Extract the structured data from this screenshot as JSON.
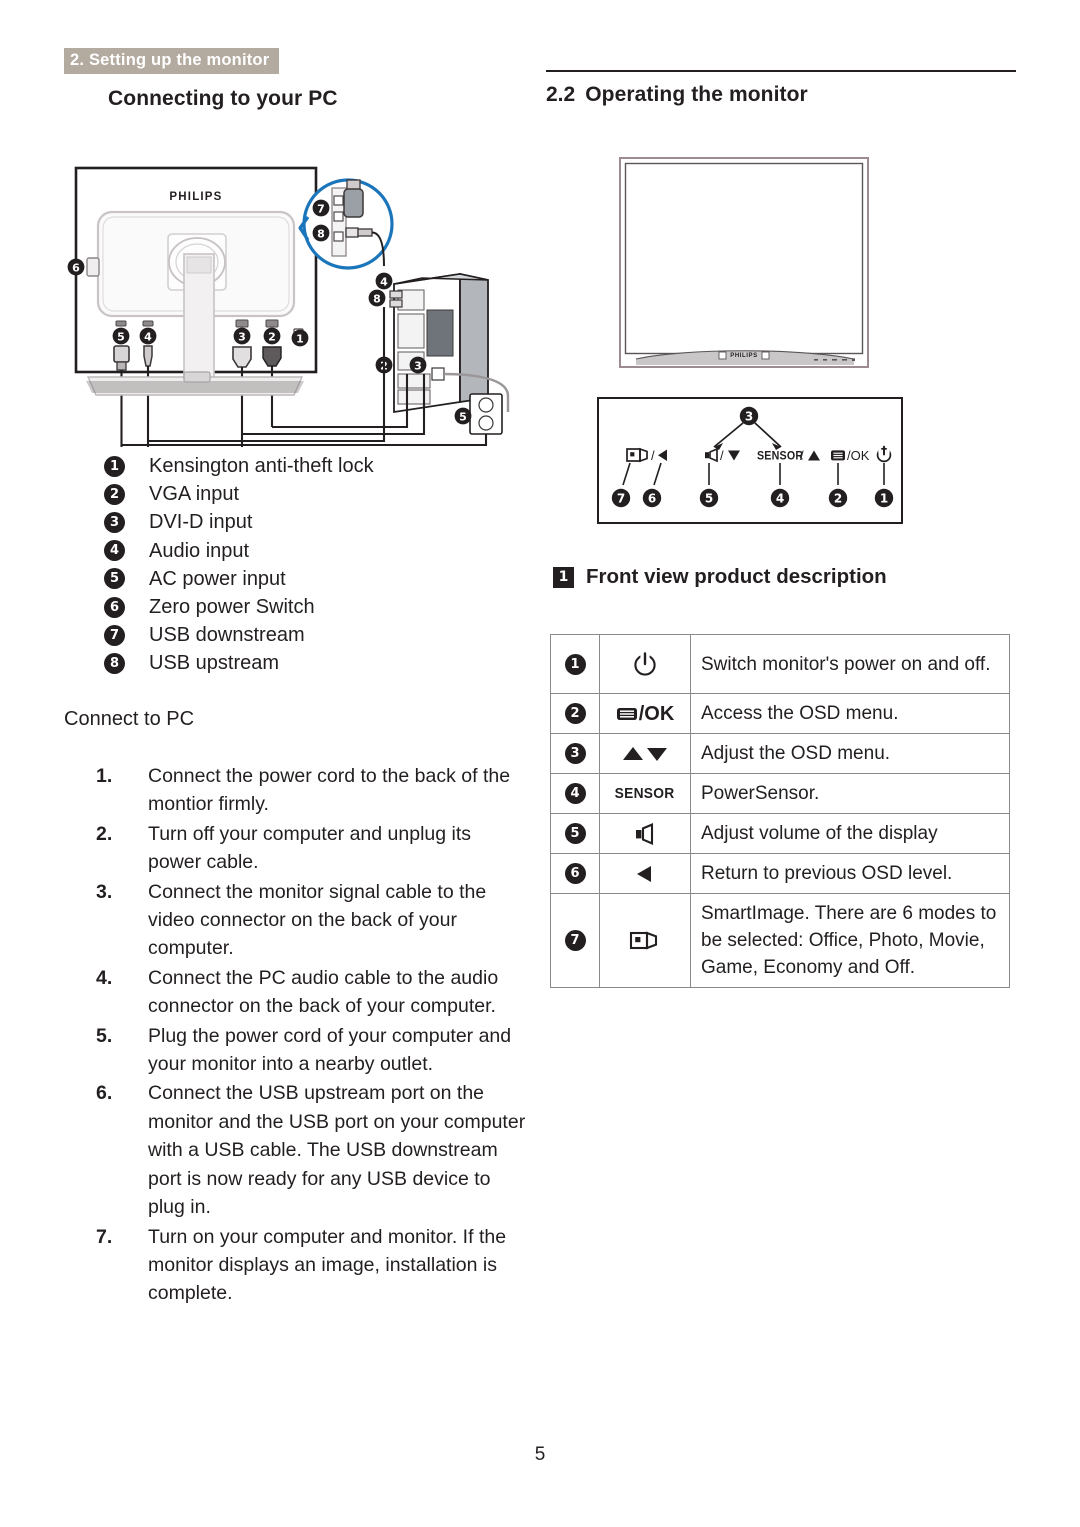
{
  "header": {
    "banner": "2. Setting up the monitor"
  },
  "left": {
    "heading": "Connecting to your PC",
    "diagram": {
      "brand": "PHILIPS",
      "callout_labels": [
        "7",
        "8"
      ],
      "monitor_port_labels": [
        "1",
        "2",
        "3",
        "4",
        "5",
        "6"
      ],
      "pc_labels": [
        "2",
        "3",
        "4",
        "5",
        "8"
      ]
    },
    "legend": [
      {
        "num": "1",
        "label": "Kensington anti-theft lock"
      },
      {
        "num": "2",
        "label": "VGA input"
      },
      {
        "num": "3",
        "label": "DVI-D input"
      },
      {
        "num": "4",
        "label": "Audio input"
      },
      {
        "num": "5",
        "label": "AC power input"
      },
      {
        "num": "6",
        "label": "Zero power Switch"
      },
      {
        "num": "7",
        "label": "USB downstream"
      },
      {
        "num": "8",
        "label": "USB upstream"
      }
    ],
    "connect_subhead": "Connect to PC",
    "steps": [
      {
        "num": "1.",
        "text": "Connect the power cord to the back of the montior firmly."
      },
      {
        "num": "2.",
        "text": "Turn off your computer and unplug its power cable."
      },
      {
        "num": "3.",
        "text": "Connect the monitor signal cable to the video connector on the back of your computer."
      },
      {
        "num": "4.",
        "text": "Connect the PC audio cable to the audio connector on the back of your computer."
      },
      {
        "num": "5.",
        "text": "Plug the power cord of your computer and your monitor into a nearby outlet."
      },
      {
        "num": "6.",
        "text": "Connect the USB upstream port on the monitor and the USB port on your computer with a USB cable. The USB downstream port is now ready for any USB device to plug in."
      },
      {
        "num": "7.",
        "text": "Turn on your computer and monitor. If the monitor displays an image, installation is complete."
      }
    ]
  },
  "right": {
    "section_number": "2.2",
    "heading": "Operating the monitor",
    "front_monitor_brand": "PHILIPS",
    "osd_callout": {
      "top_label": "3",
      "buttons": [
        {
          "num": "7",
          "glyph": "smartimage/left"
        },
        {
          "num": "6",
          "glyph": "left-arrow"
        },
        {
          "num": "5",
          "glyph": "volume/down"
        },
        {
          "num": "4",
          "glyph": "SENSOR /up"
        },
        {
          "num": "2",
          "glyph": "menu/OK"
        },
        {
          "num": "1",
          "glyph": "power"
        }
      ],
      "label_7": "/",
      "label_6": "/",
      "label_5": "/",
      "label_4": "SENSOR /",
      "label_2": "/OK",
      "label_1": "power"
    },
    "front_view": {
      "marker": "1",
      "title": "Front view product description"
    },
    "table": [
      {
        "num": "1",
        "icon": "power-icon",
        "icon_text": "",
        "desc": "Switch monitor's power on and off."
      },
      {
        "num": "2",
        "icon": "menu-ok-icon",
        "icon_text": "/OK",
        "desc": "Access the OSD menu."
      },
      {
        "num": "3",
        "icon": "up-down-arrows-icon",
        "icon_text": "",
        "desc": "Adjust the OSD menu."
      },
      {
        "num": "4",
        "icon": "sensor-label-icon",
        "icon_text": "SENSOR",
        "desc": "PowerSensor."
      },
      {
        "num": "5",
        "icon": "volume-icon",
        "icon_text": "",
        "desc": "Adjust volume of the display"
      },
      {
        "num": "6",
        "icon": "left-arrow-icon",
        "icon_text": "",
        "desc": "Return to previous OSD level."
      },
      {
        "num": "7",
        "icon": "smartimage-icon",
        "icon_text": "",
        "desc": "SmartImage. There are 6 modes to be selected: Office, Photo, Movie, Game, Economy and Off."
      }
    ]
  },
  "footer": {
    "page_number": "5"
  },
  "colors": {
    "banner_bg": "#b3aaa0",
    "banner_text": "#ffffff",
    "body_text": "#231f20",
    "callout_blue": "#1b75bb",
    "table_border": "#8a8a8a"
  }
}
